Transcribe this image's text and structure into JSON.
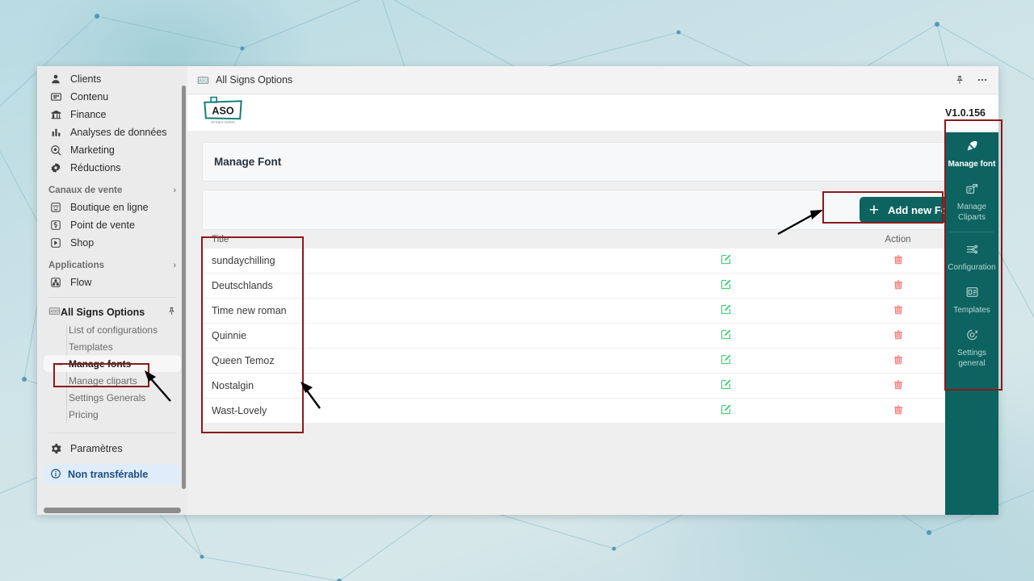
{
  "window": {
    "tab_title": "All Signs Options",
    "version": "V1.0.156",
    "logo_text": "ASO",
    "logo_subtext": "All Signs Options"
  },
  "sidebar": {
    "items": [
      {
        "label": "Clients",
        "icon": "person-icon"
      },
      {
        "label": "Contenu",
        "icon": "content-icon"
      },
      {
        "label": "Finance",
        "icon": "bank-icon"
      },
      {
        "label": "Analyses de données",
        "icon": "bar-chart-icon"
      },
      {
        "label": "Marketing",
        "icon": "marketing-icon"
      },
      {
        "label": "Réductions",
        "icon": "discount-icon"
      }
    ],
    "sections": [
      {
        "title": "Canaux de vente",
        "items": [
          {
            "label": "Boutique en ligne",
            "icon": "storefront-icon"
          },
          {
            "label": "Point de vente",
            "icon": "pos-icon"
          },
          {
            "label": "Shop",
            "icon": "shop-icon"
          }
        ]
      },
      {
        "title": "Applications",
        "items": [
          {
            "label": "Flow",
            "icon": "flow-icon"
          }
        ]
      }
    ],
    "app": {
      "label": "All Signs Options",
      "icon": "aso-app-icon",
      "pin_icon": "pin-icon",
      "sub_items": [
        {
          "label": "List of configurations",
          "active": false
        },
        {
          "label": "Templates",
          "active": false
        },
        {
          "label": "Manage fonts",
          "active": true
        },
        {
          "label": "Manage cliparts",
          "active": false
        },
        {
          "label": "Settings Generals",
          "active": false
        },
        {
          "label": "Pricing",
          "active": false
        }
      ]
    },
    "settings": {
      "label": "Paramètres",
      "icon": "gear-icon"
    },
    "notice": {
      "label": "Non transférable",
      "icon": "info-icon"
    }
  },
  "topbar": {
    "pin_icon": "pin-icon",
    "more_icon": "more-horizontal-icon"
  },
  "main": {
    "card_title": "Manage Font",
    "add_button": "Add new Font",
    "add_button_icon": "plus-icon",
    "table": {
      "columns": [
        "Title",
        "",
        "Action"
      ],
      "rows": [
        {
          "title": "sundaychilling",
          "edit_icon": "edit-icon",
          "delete_icon": "trash-icon"
        },
        {
          "title": "Deutschlands",
          "edit_icon": "edit-icon",
          "delete_icon": "trash-icon"
        },
        {
          "title": "Time new roman",
          "edit_icon": "edit-icon",
          "delete_icon": "trash-icon"
        },
        {
          "title": "Quinnie",
          "edit_icon": "edit-icon",
          "delete_icon": "trash-icon"
        },
        {
          "title": "Queen Temoz",
          "edit_icon": "edit-icon",
          "delete_icon": "trash-icon"
        },
        {
          "title": "Nostalgin",
          "edit_icon": "edit-icon",
          "delete_icon": "trash-icon"
        },
        {
          "title": "Wast-Lovely",
          "edit_icon": "edit-icon",
          "delete_icon": "trash-icon"
        }
      ]
    }
  },
  "rail": {
    "group_one": [
      {
        "label": "Manage font",
        "icon": "font-manage-icon",
        "active": true
      },
      {
        "label": "Manage Cliparts",
        "icon": "clipart-icon",
        "active": false
      }
    ],
    "group_two": [
      {
        "label": "Configuration",
        "icon": "sliders-icon",
        "active": false
      },
      {
        "label": "Templates",
        "icon": "templates-icon",
        "active": false
      },
      {
        "label": "Settings general",
        "icon": "settings-code-icon",
        "active": false
      }
    ]
  },
  "colors": {
    "teal": "#0c6360",
    "annotation_red": "#8b1a1a",
    "edit_green": "#4cd07d",
    "delete_red": "#f2726f",
    "notice_blue": "#dfedfa"
  }
}
